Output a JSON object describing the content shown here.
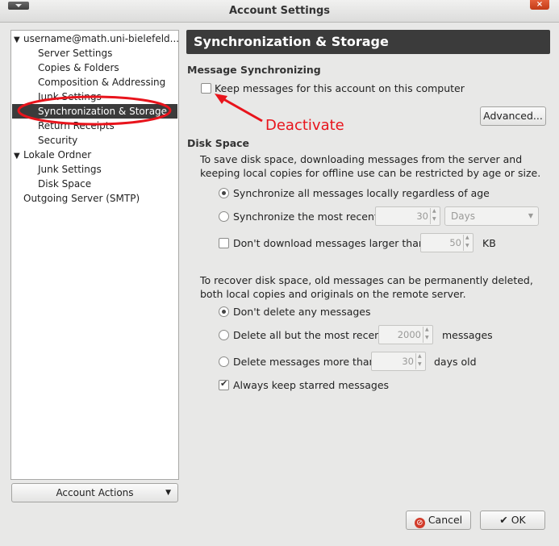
{
  "window": {
    "title": "Account Settings"
  },
  "tree": {
    "items": [
      {
        "label": "username@math.uni-bielefeld...",
        "expanded": true
      },
      {
        "label": "Server Settings"
      },
      {
        "label": "Copies & Folders"
      },
      {
        "label": "Composition & Addressing"
      },
      {
        "label": "Junk Settings"
      },
      {
        "label": "Synchronization & Storage",
        "selected": true
      },
      {
        "label": "Return Receipts"
      },
      {
        "label": "Security"
      },
      {
        "label": "Lokale Ordner",
        "expanded": true
      },
      {
        "label": "Junk Settings"
      },
      {
        "label": "Disk Space"
      },
      {
        "label": "Outgoing Server (SMTP)"
      }
    ]
  },
  "account_actions": {
    "label": "Account Actions"
  },
  "pane": {
    "header": "Synchronization & Storage",
    "message_sync": {
      "title": "Message Synchronizing",
      "keep_messages_label": "Keep messages for this account on this computer",
      "keep_messages_checked": false,
      "advanced_button": "Advanced..."
    },
    "disk_space": {
      "title": "Disk Space",
      "description": "To save disk space, downloading messages from the server and keeping local copies for offline use can be restricted by age or size.",
      "sync_all_label": "Synchronize all messages locally regardless of age",
      "sync_recent_label": "Synchronize the most recent",
      "sync_recent_value": "30",
      "sync_recent_unit": "Days",
      "dont_download_label": "Don't download messages larger than",
      "dont_download_value": "50",
      "dont_download_unit": "KB",
      "recover_description": "To recover disk space, old messages can be permanently deleted, both local copies and originals on the remote server.",
      "dont_delete_label": "Don't delete any messages",
      "delete_all_but_label": "Delete all but the most recent",
      "delete_all_but_value": "2000",
      "delete_all_but_unit": "messages",
      "delete_older_label": "Delete messages more than",
      "delete_older_value": "30",
      "delete_older_unit": "days old",
      "keep_starred_label": "Always keep starred messages"
    }
  },
  "annotation": {
    "text": "Deactivate",
    "color": "#e8141c"
  },
  "buttons": {
    "cancel": "Cancel",
    "ok": "OK"
  }
}
